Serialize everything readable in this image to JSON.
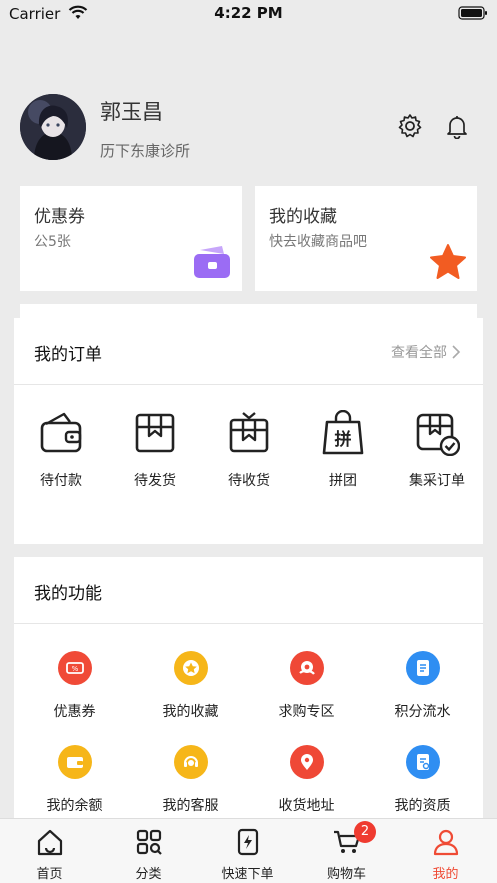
{
  "status_bar": {
    "carrier": "Carrier",
    "time": "4:22 PM"
  },
  "profile": {
    "name": "郭玉昌",
    "organization": "历下东康诊所"
  },
  "cards": {
    "coupons": {
      "title": "优惠券",
      "subtitle": "公5张"
    },
    "favorites": {
      "title": "我的收藏",
      "subtitle": "快去收藏商品吧"
    }
  },
  "orders": {
    "title": "我的订单",
    "view_all": "查看全部",
    "items": [
      {
        "label": "待付款",
        "icon": "wallet-icon"
      },
      {
        "label": "待发货",
        "icon": "box-icon"
      },
      {
        "label": "待收货",
        "icon": "package-receive-icon"
      },
      {
        "label": "拼团",
        "icon": "group-buy-bag-icon"
      },
      {
        "label": "集采订单",
        "icon": "bulk-order-icon"
      }
    ]
  },
  "functions": {
    "title": "我的功能",
    "items": [
      {
        "label": "优惠券",
        "icon": "coupon-icon",
        "color": "#f04a37"
      },
      {
        "label": "我的收藏",
        "icon": "star-icon",
        "color": "#f6b619"
      },
      {
        "label": "求购专区",
        "icon": "purchase-request-icon",
        "color": "#ef4836"
      },
      {
        "label": "积分流水",
        "icon": "points-doc-icon",
        "color": "#2f8ef2"
      },
      {
        "label": "我的余额",
        "icon": "balance-wallet-icon",
        "color": "#f6b619"
      },
      {
        "label": "我的客服",
        "icon": "customer-service-icon",
        "color": "#f6b619"
      },
      {
        "label": "收货地址",
        "icon": "location-pin-icon",
        "color": "#ef4836"
      },
      {
        "label": "我的资质",
        "icon": "qualification-icon",
        "color": "#2f8ef2"
      }
    ]
  },
  "tabs": [
    {
      "label": "首页",
      "icon": "home-icon",
      "active": false
    },
    {
      "label": "分类",
      "icon": "category-icon",
      "active": false
    },
    {
      "label": "快速下单",
      "icon": "quick-order-icon",
      "active": false
    },
    {
      "label": "购物车",
      "icon": "cart-icon",
      "active": false,
      "badge": "2"
    },
    {
      "label": "我的",
      "icon": "user-icon",
      "active": true
    }
  ],
  "colors": {
    "accent": "#ef4b35",
    "coupon_card_icon": "#9b6cf4",
    "favorite_star": "#f25c22"
  }
}
